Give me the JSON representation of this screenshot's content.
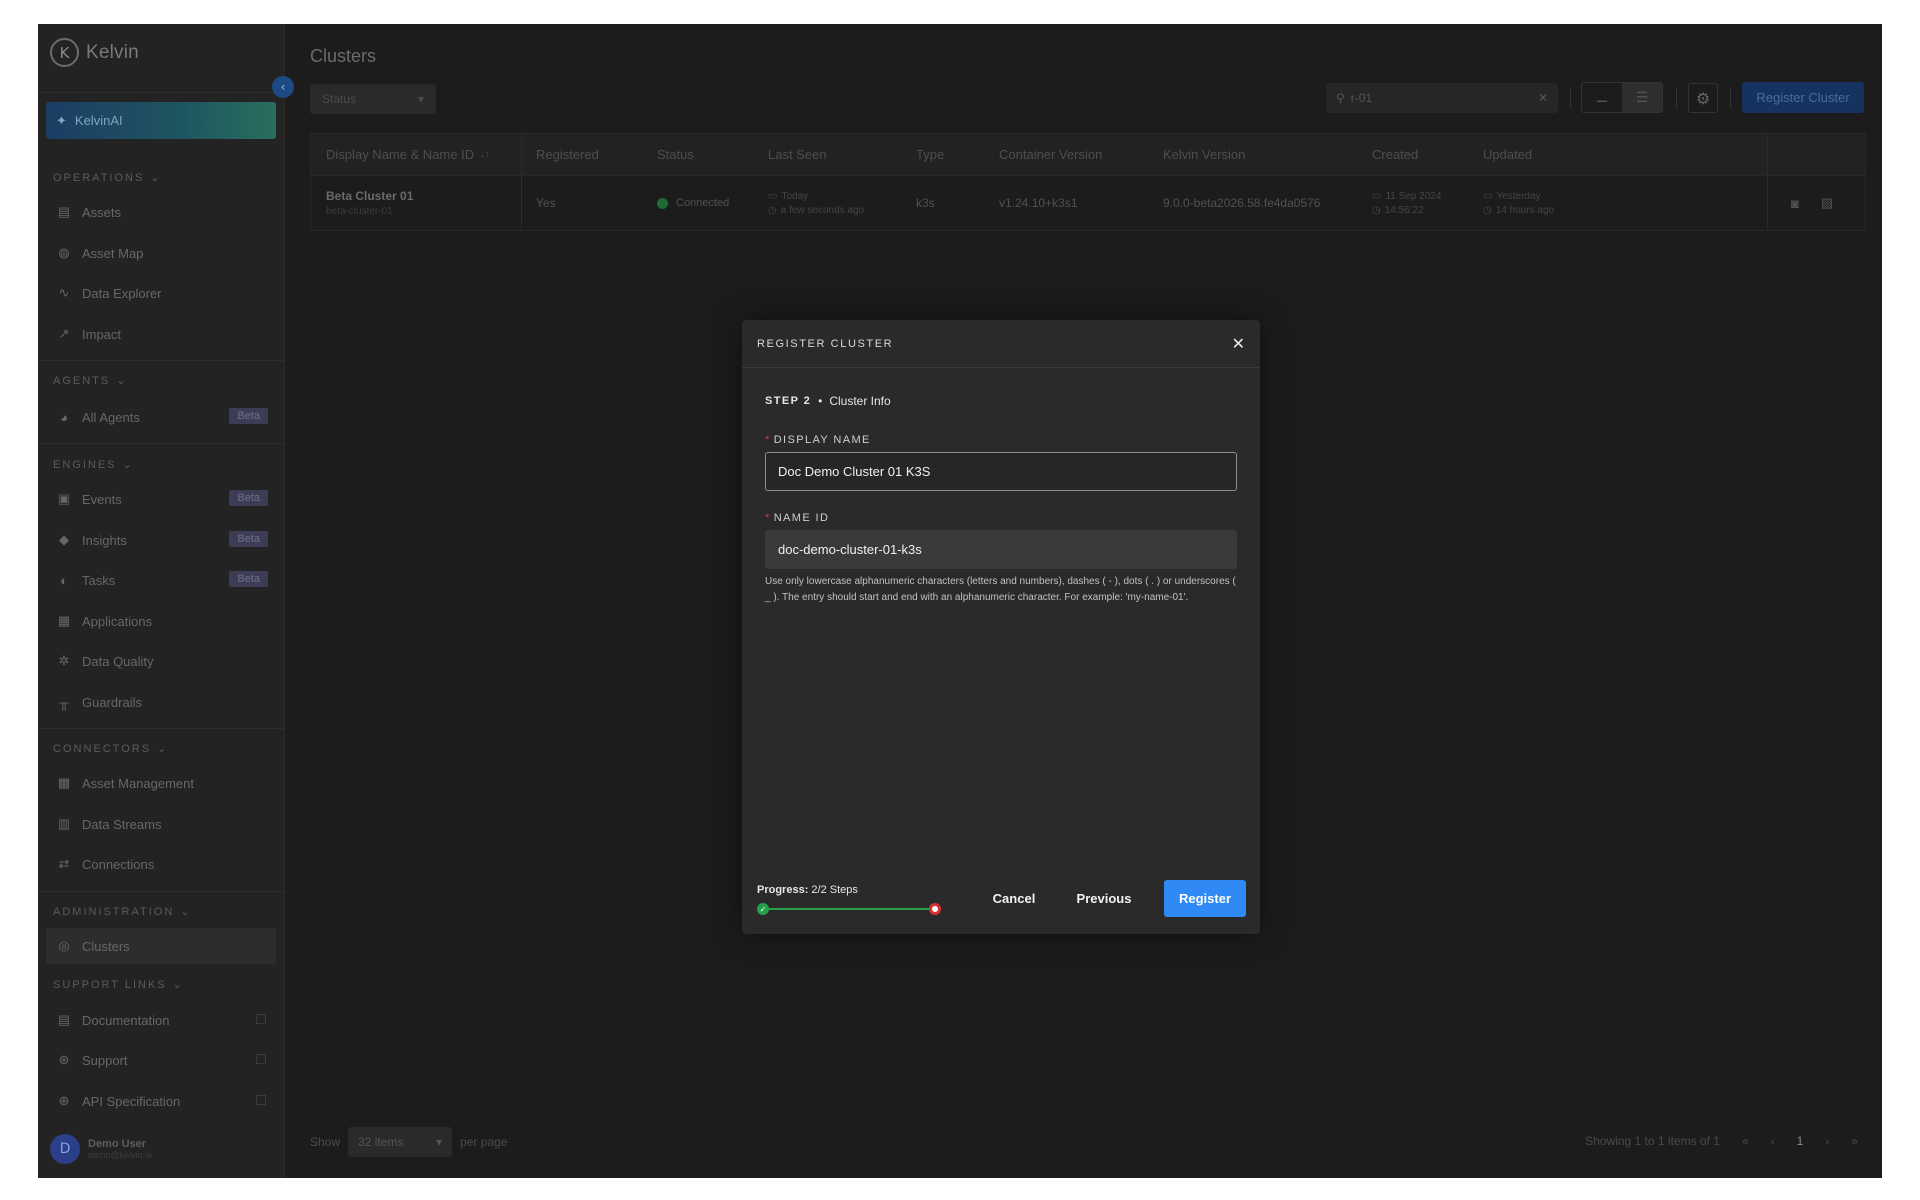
{
  "app": {
    "logo_text": "Kelvin",
    "logo_mark": "K"
  },
  "sidebar": {
    "kelvinai_label": "KelvinAI",
    "sections": {
      "operations": "OPERATIONS",
      "agents": "AGENTS",
      "engines": "ENGINES",
      "connectors": "CONNECTORS",
      "administration": "ADMINISTRATION",
      "support": "SUPPORT LINKS"
    },
    "items": {
      "assets": "Assets",
      "asset_map": "Asset Map",
      "data_explorer": "Data Explorer",
      "impact": "Impact",
      "all_agents": "All Agents",
      "events": "Events",
      "insights": "Insights",
      "tasks": "Tasks",
      "applications": "Applications",
      "data_quality": "Data Quality",
      "guardrails": "Guardrails",
      "asset_management": "Asset Management",
      "data_streams": "Data Streams",
      "connections": "Connections",
      "clusters": "Clusters",
      "documentation": "Documentation",
      "support": "Support",
      "api_spec": "API Specification"
    },
    "badge": "Beta",
    "user": {
      "initial": "D",
      "name": "Demo User",
      "email": "demo@kelvin.ai"
    }
  },
  "page": {
    "title": "Clusters",
    "status_filter": "Status",
    "search_value": "r-01",
    "register_button": "Register Cluster"
  },
  "table": {
    "headers": [
      "Display Name & Name ID",
      "Registered",
      "Status",
      "Last Seen",
      "Type",
      "Container Version",
      "Kelvin Version",
      "Created",
      "Updated"
    ],
    "sort_glyph": "↓↑",
    "rows": [
      {
        "display_name": "Beta Cluster 01",
        "name_id": "beta-cluster-01",
        "registered": "Yes",
        "status": "Connected",
        "last_seen_date": "Today",
        "last_seen_time": "a few seconds ago",
        "type": "k3s",
        "container_version": "v1.24.10+k3s1",
        "kelvin_version": "9.0.0-beta2026.58.fe4da0576",
        "created_date": "11 Sep 2024",
        "created_time": "14:56:22",
        "updated_date": "Yesterday",
        "updated_time": "14 hours ago"
      }
    ]
  },
  "footer": {
    "show": "Show",
    "per_page_value": "32 items",
    "per_page": "per page",
    "showing": "Showing 1 to 1 items of 1",
    "page": "1"
  },
  "modal": {
    "title": "REGISTER CLUSTER",
    "step_label": "STEP 2",
    "step_bullet": "•",
    "step_name": "Cluster Info",
    "display_name_label": "DISPLAY NAME",
    "display_name_value": "Doc Demo Cluster 01 K3S",
    "name_id_label": "NAME ID",
    "name_id_value": "doc-demo-cluster-01-k3s",
    "help_text": "Use only lowercase alphanumeric characters (letters and numbers), dashes ( - ), dots ( . ) or underscores ( _ ). The entry should start and end with an alphanumeric character. For example: 'my-name-01'.",
    "progress_label": "Progress:",
    "progress_value": "2/2 Steps",
    "progress_fraction": 1.0,
    "cancel": "Cancel",
    "previous": "Previous",
    "register": "Register",
    "required_mark": "*"
  },
  "colors": {
    "accent": "#2f8af5",
    "success": "#25a04b",
    "required": "#d23c3c"
  }
}
